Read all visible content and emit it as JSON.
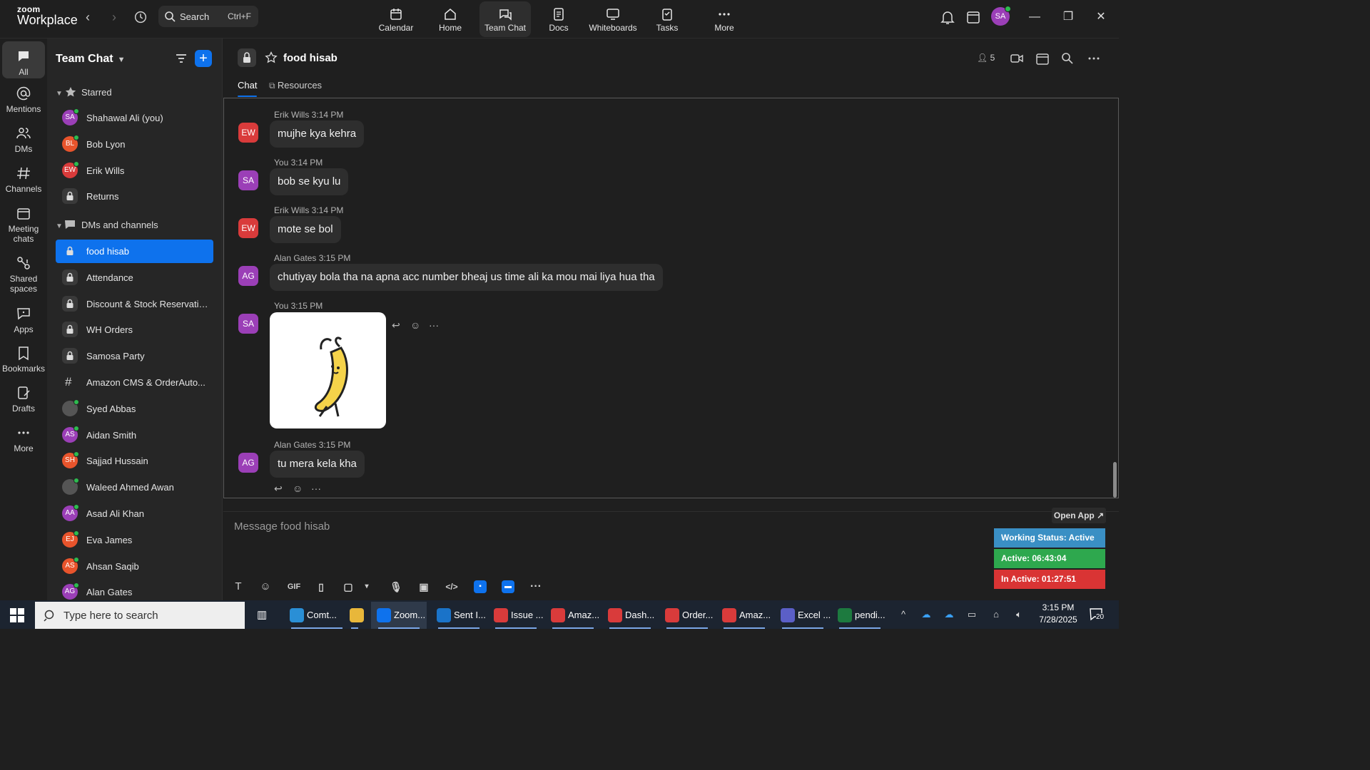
{
  "topbar": {
    "logo_line1": "zoom",
    "logo_line2": "Workplace",
    "search_label": "Search",
    "search_shortcut": "Ctrl+F",
    "tabs": [
      {
        "label": "Calendar",
        "icon": "calendar-icon"
      },
      {
        "label": "Home",
        "icon": "home-icon"
      },
      {
        "label": "Team Chat",
        "icon": "chat-icon"
      },
      {
        "label": "Docs",
        "icon": "docs-icon"
      },
      {
        "label": "Whiteboards",
        "icon": "whiteboard-icon"
      },
      {
        "label": "Tasks",
        "icon": "tasks-icon"
      },
      {
        "label": "More",
        "icon": "more-icon"
      }
    ],
    "active_tab": "Team Chat",
    "avatar_initials": "SA"
  },
  "rail": {
    "items": [
      {
        "label": "All",
        "icon": "chat-bubble-icon"
      },
      {
        "label": "Mentions",
        "icon": "at-icon"
      },
      {
        "label": "DMs",
        "icon": "people-icon"
      },
      {
        "label": "Channels",
        "icon": "hash-icon"
      },
      {
        "label": "Meeting chats",
        "icon": "calendar-icon"
      },
      {
        "label": "Shared spaces",
        "icon": "shared-spaces-icon"
      },
      {
        "label": "Apps",
        "icon": "apps-icon"
      },
      {
        "label": "Bookmarks",
        "icon": "bookmark-icon"
      },
      {
        "label": "Drafts",
        "icon": "drafts-icon"
      },
      {
        "label": "More",
        "icon": "more-icon"
      }
    ],
    "active": "All"
  },
  "sidebar": {
    "title": "Team Chat",
    "starred_label": "Starred",
    "dms_label": "DMs and channels",
    "starred": [
      {
        "label": "Shahawal Ali (you)",
        "initials": "SA",
        "color": "#9b3fb7",
        "online": true,
        "kind": "avatar"
      },
      {
        "label": "Bob Lyon",
        "initials": "BL",
        "color": "#e8542c",
        "online": true,
        "kind": "avatar"
      },
      {
        "label": "Erik Wills",
        "initials": "EW",
        "color": "#d93b3b",
        "online": true,
        "kind": "avatar"
      },
      {
        "label": "Returns",
        "kind": "lock"
      }
    ],
    "channels": [
      {
        "label": "food hisab",
        "kind": "lock",
        "active": true
      },
      {
        "label": "Attendance",
        "kind": "lock"
      },
      {
        "label": "Discount & Stock Reservatio...",
        "kind": "lock"
      },
      {
        "label": "WH Orders",
        "kind": "lock"
      },
      {
        "label": "Samosa Party",
        "kind": "lock"
      },
      {
        "label": "Amazon CMS & OrderAuto...",
        "kind": "hash"
      },
      {
        "label": "Syed Abbas",
        "kind": "photo",
        "online": true
      },
      {
        "label": "Aidan Smith",
        "initials": "AS",
        "color": "#9b3fb7",
        "online": true,
        "kind": "avatar"
      },
      {
        "label": "Sajjad Hussain",
        "initials": "SH",
        "color": "#e8542c",
        "online": true,
        "kind": "avatar"
      },
      {
        "label": "Waleed Ahmed Awan",
        "kind": "photo",
        "online": true
      },
      {
        "label": "Asad Ali Khan",
        "initials": "AA",
        "color": "#9b3fb7",
        "online": true,
        "kind": "avatar"
      },
      {
        "label": "Eva James",
        "initials": "EJ",
        "color": "#e8542c",
        "online": true,
        "kind": "avatar"
      },
      {
        "label": "Ahsan Saqib",
        "initials": "AS",
        "color": "#e8542c",
        "online": true,
        "kind": "avatar"
      },
      {
        "label": "Alan Gates",
        "initials": "AG",
        "color": "#9b3fb7",
        "online": true,
        "kind": "avatar"
      }
    ]
  },
  "chat": {
    "title": "food hisab",
    "tabs": [
      "Chat",
      "Resources"
    ],
    "member_count": "5",
    "messages": [
      {
        "sender": "Erik Wills",
        "time": "3:14 PM",
        "initials": "EW",
        "color": "#d93b3b",
        "text": "mujhe kya kehra"
      },
      {
        "sender": "You",
        "time": "3:14 PM",
        "initials": "SA",
        "color": "#9b3fb7",
        "text": "bob se kyu lu"
      },
      {
        "sender": "Erik Wills",
        "time": "3:14 PM",
        "initials": "EW",
        "color": "#d93b3b",
        "text": "mote se bol"
      },
      {
        "sender": "Alan Gates",
        "time": "3:15 PM",
        "initials": "AG",
        "color": "#9b3fb7",
        "text": "chutiyay bola tha na apna acc number bheaj us time ali ka mou mai liya hua tha"
      },
      {
        "sender": "You",
        "time": "3:15 PM",
        "initials": "SA",
        "color": "#9b3fb7",
        "sticker": "banana-sticker"
      },
      {
        "sender": "Alan Gates",
        "time": "3:15 PM",
        "initials": "AG",
        "color": "#9b3fb7",
        "text": "tu mera kela kha"
      }
    ],
    "composer_placeholder": "Message food hisab"
  },
  "widget": {
    "open_app": "Open App ↗",
    "working_status": "Working Status: Active",
    "active_time": "Active: 06:43:04",
    "inactive_time": "In Active: 01:27:51",
    "colors": {
      "status": "#3a8fc4",
      "active": "#2ea84e",
      "inactive": "#d93434"
    }
  },
  "taskbar": {
    "search_placeholder": "Type here to search",
    "apps": [
      {
        "label": "Comt...",
        "icon": "chat-app-icon",
        "color": "#2a8fd6"
      },
      {
        "label": "",
        "icon": "folder-icon",
        "color": "#e8b73a"
      },
      {
        "label": "Zoom...",
        "icon": "zoom-icon",
        "color": "#0e72ed",
        "active": true
      },
      {
        "label": "Sent I...",
        "icon": "outlook-icon",
        "color": "#1a73c9"
      },
      {
        "label": "Issue ...",
        "icon": "chrome-icon",
        "color": "#d93b3b"
      },
      {
        "label": "Amaz...",
        "icon": "chrome-icon",
        "color": "#d93b3b"
      },
      {
        "label": "Dash...",
        "icon": "chrome-icon",
        "color": "#d93b3b"
      },
      {
        "label": "Order...",
        "icon": "chrome-icon",
        "color": "#d93b3b"
      },
      {
        "label": "Amaz...",
        "icon": "chrome-icon",
        "color": "#d93b3b"
      },
      {
        "label": "Excel ...",
        "icon": "teams-icon",
        "color": "#5b5fc7"
      },
      {
        "label": "pendi...",
        "icon": "excel-icon",
        "color": "#1d7a3f"
      }
    ],
    "time": "3:15 PM",
    "date": "7/28/2025",
    "notification_count": "20"
  }
}
